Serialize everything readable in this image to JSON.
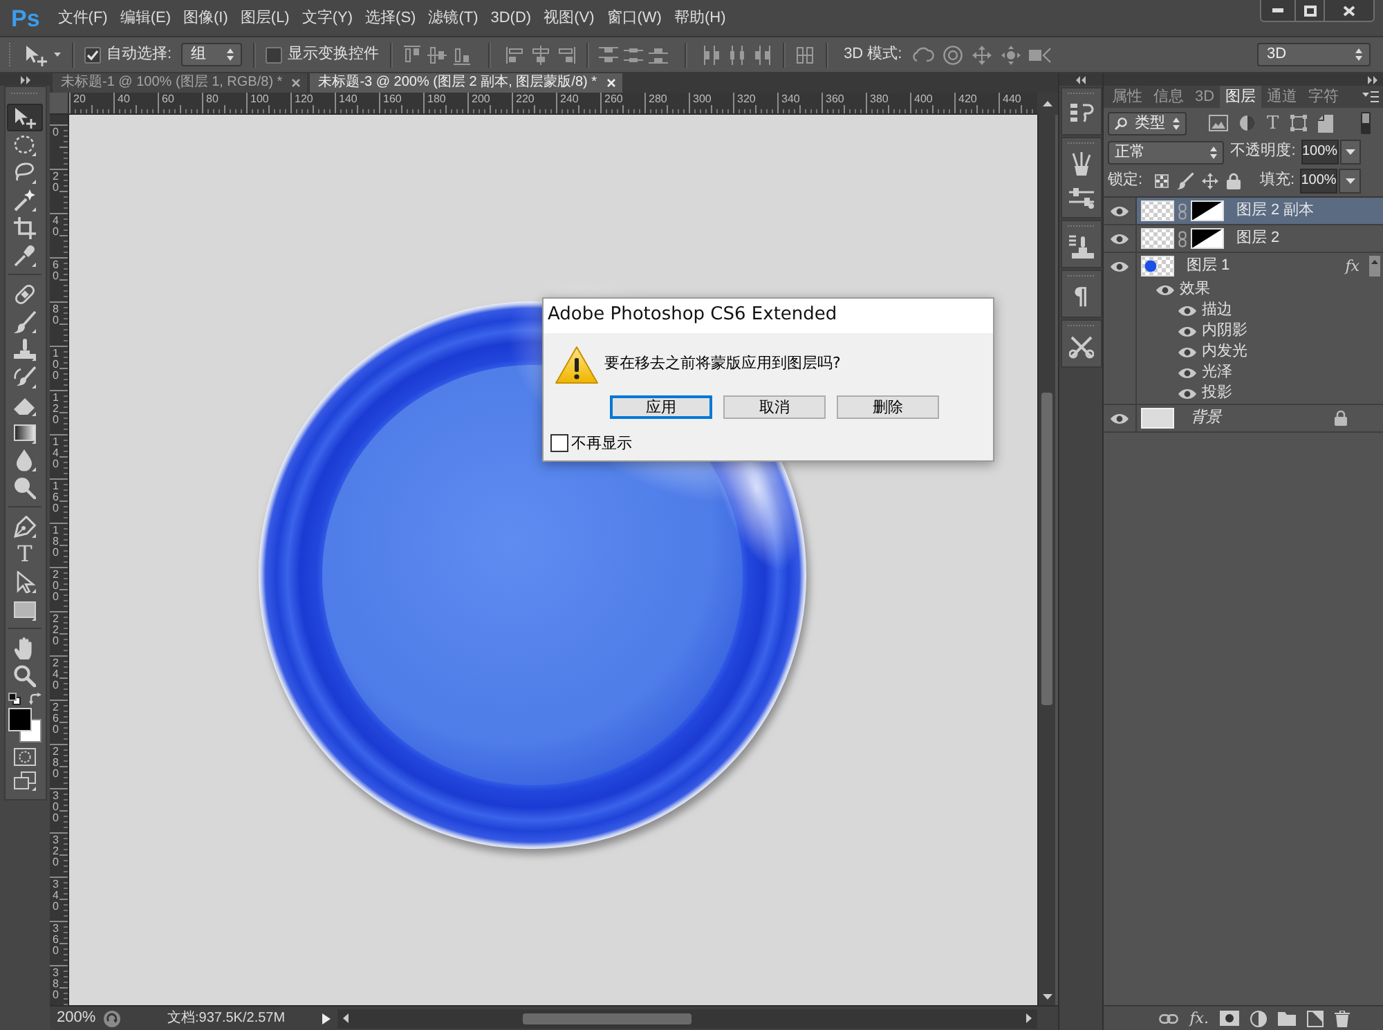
{
  "app": {
    "logo": "Ps"
  },
  "menu": [
    "文件(F)",
    "编辑(E)",
    "图像(I)",
    "图层(L)",
    "文字(Y)",
    "选择(S)",
    "滤镜(T)",
    "3D(D)",
    "视图(V)",
    "窗口(W)",
    "帮助(H)"
  ],
  "options_bar": {
    "auto_select": {
      "label": "自动选择:",
      "checked": true
    },
    "auto_select_target": "组",
    "show_transform_controls": {
      "label": "显示变换控件",
      "checked": false
    },
    "mode_3d_label": "3D 模式:",
    "workspace": "3D"
  },
  "tool_groups": [
    {
      "tools": [
        {
          "kind": "move",
          "selected": true
        },
        {
          "kind": "marquee",
          "selected": false
        },
        {
          "kind": "lasso",
          "selected": false
        },
        {
          "kind": "wand",
          "selected": false
        },
        {
          "kind": "crop",
          "selected": false
        },
        {
          "kind": "eyedropper",
          "selected": false
        }
      ]
    },
    {
      "tools": [
        {
          "kind": "healing",
          "selected": false
        },
        {
          "kind": "brush",
          "selected": false
        },
        {
          "kind": "stamp",
          "selected": false
        },
        {
          "kind": "history_brush",
          "selected": false
        },
        {
          "kind": "eraser",
          "selected": false
        },
        {
          "kind": "gradient",
          "selected": false
        },
        {
          "kind": "blur",
          "selected": false
        },
        {
          "kind": "dodge",
          "selected": false
        }
      ]
    },
    {
      "tools": [
        {
          "kind": "pen",
          "selected": false
        },
        {
          "kind": "type",
          "glyph": "T",
          "selected": false
        },
        {
          "kind": "path_select",
          "selected": false
        },
        {
          "kind": "shape",
          "selected": false
        }
      ]
    },
    {
      "tools": [
        {
          "kind": "hand",
          "selected": false
        },
        {
          "kind": "zoom",
          "selected": false
        }
      ]
    }
  ],
  "document_tabs": [
    {
      "title": "未标题-1 @ 100% (图层 1, RGB/8) *",
      "selected": false
    },
    {
      "title": "未标题-3 @ 200% (图层 2 副本, 图层蒙版/8) *",
      "selected": true
    }
  ],
  "rulers": {
    "horizontal": [
      "20",
      "40",
      "60",
      "80",
      "100",
      "120",
      "140",
      "160",
      "180",
      "200",
      "220",
      "240",
      "260",
      "280",
      "300",
      "320",
      "340",
      "360",
      "380",
      "400",
      "420",
      "440"
    ],
    "vertical": [
      "0",
      "20",
      "40",
      "60",
      "80",
      "100",
      "120",
      "140",
      "160",
      "180",
      "200",
      "220",
      "240",
      "260",
      "280",
      "300",
      "320",
      "340",
      "360",
      "380"
    ]
  },
  "status_bar": {
    "zoom": "200%",
    "document_info": "文档:937.5K/2.57M"
  },
  "dock": {
    "paragraph_glyph": "¶"
  },
  "layers_panel": {
    "tabs": [
      {
        "label": "属性",
        "selected": false
      },
      {
        "label": "信息",
        "selected": false
      },
      {
        "label": "3D",
        "selected": false
      },
      {
        "label": "图层",
        "selected": true
      },
      {
        "label": "通道",
        "selected": false
      },
      {
        "label": "字符",
        "selected": false
      }
    ],
    "filter": "类型",
    "type_filter_glyph": "T",
    "filter_on": false,
    "blend_mode": "正常",
    "opacity_label": "不透明度:",
    "opacity": "100%",
    "lock_label": "锁定:",
    "fill_label": "填充:",
    "fill": "100%",
    "layers": [
      {
        "kind": "masked",
        "name": "图层 2 副本",
        "selected": true,
        "visible": true,
        "locked": false
      },
      {
        "kind": "masked",
        "name": "图层 2",
        "selected": false,
        "visible": true,
        "locked": false
      },
      {
        "kind": "effects",
        "name": "图层 1",
        "selected": false,
        "visible": true,
        "locked": false,
        "fx": "fx",
        "effects_label": "效果",
        "effects_visible": true,
        "effects": [
          {
            "name": "描边",
            "visible": true
          },
          {
            "name": "内阴影",
            "visible": true
          },
          {
            "name": "内发光",
            "visible": true
          },
          {
            "name": "光泽",
            "visible": true
          },
          {
            "name": "投影",
            "visible": true
          }
        ]
      },
      {
        "kind": "background",
        "name": "背景",
        "selected": false,
        "visible": true,
        "locked": true
      }
    ],
    "footer_fx": "fx."
  },
  "dialog": {
    "title": "Adobe Photoshop CS6 Extended",
    "message": "要在移去之前将蒙版应用到图层吗?",
    "buttons": [
      {
        "label": "应用",
        "default": true
      },
      {
        "label": "取消",
        "default": false
      },
      {
        "label": "删除",
        "default": false
      }
    ],
    "dont_show_again": {
      "label": "不再显示",
      "checked": false
    }
  }
}
